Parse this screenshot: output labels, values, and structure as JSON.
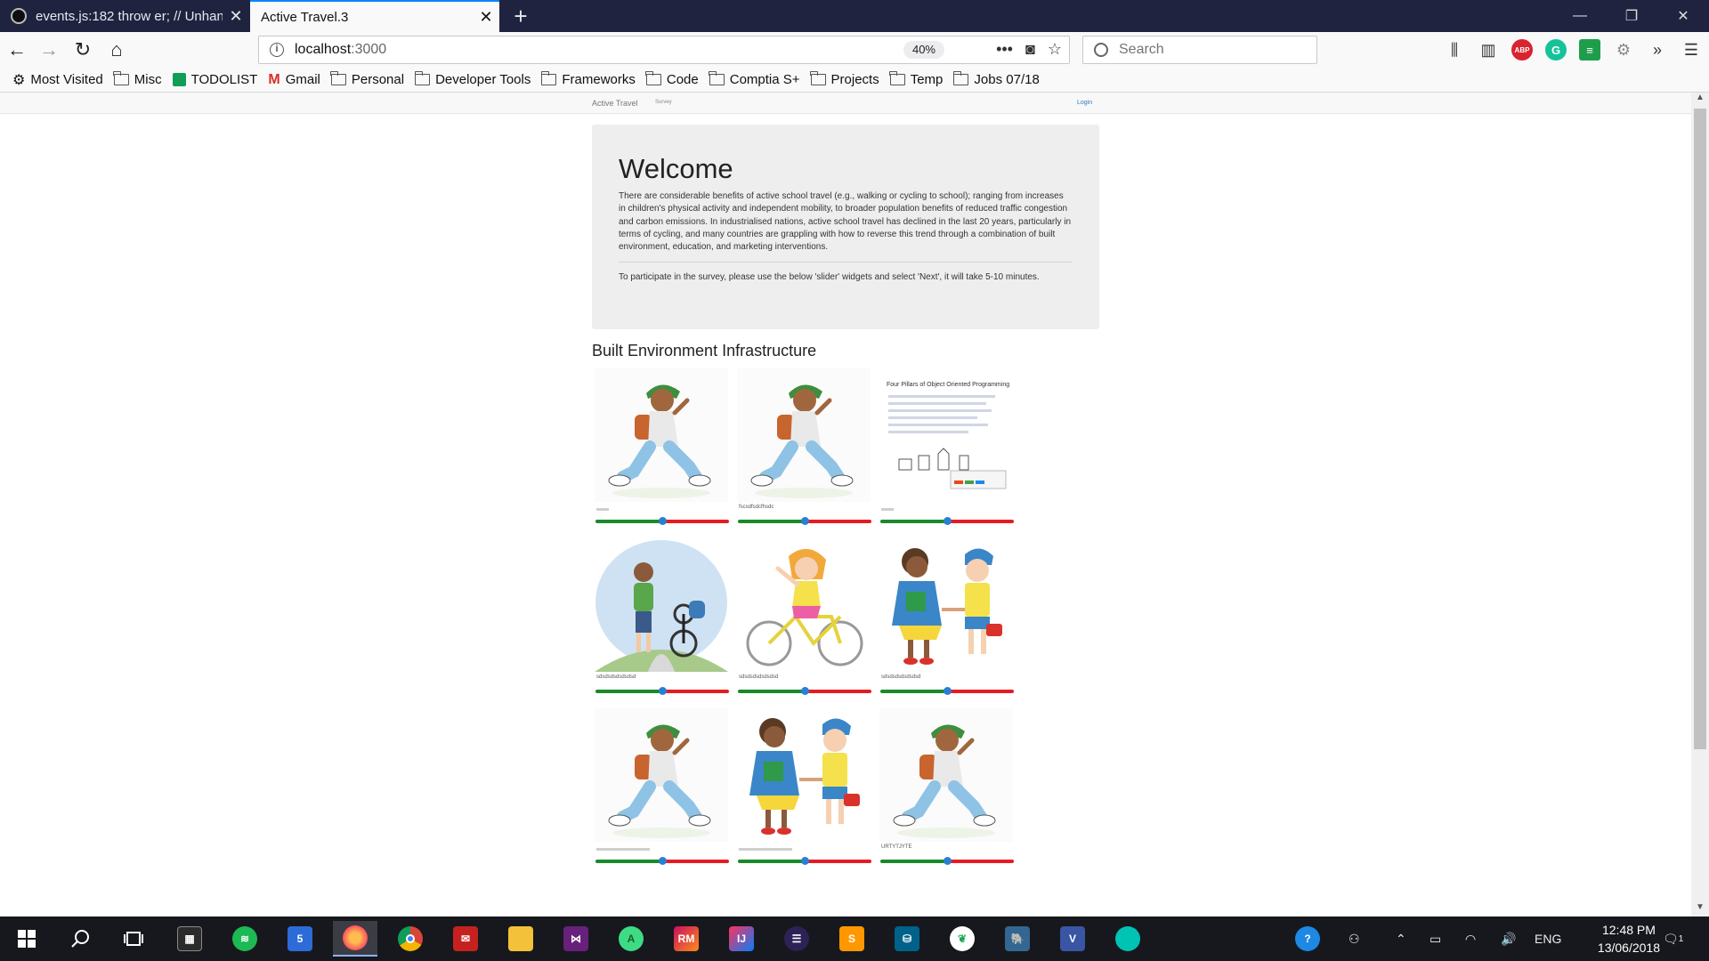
{
  "browser": {
    "tabs": [
      {
        "title": "events.js:182 throw er; // Unhan"
      },
      {
        "title": "Active Travel.3"
      }
    ],
    "new_tab_symbol": "+",
    "url_host": "localhost",
    "url_rest": ":3000",
    "zoom": "40%",
    "search_placeholder": "Search",
    "bookmarks": [
      {
        "label": "Most Visited",
        "icon": "gear-icon"
      },
      {
        "label": "Misc",
        "icon": "folder-icon"
      },
      {
        "label": "TODOLIST",
        "icon": "sheets-icon"
      },
      {
        "label": "Gmail",
        "icon": "gmail-icon"
      },
      {
        "label": "Personal",
        "icon": "folder-icon"
      },
      {
        "label": "Developer Tools",
        "icon": "folder-icon"
      },
      {
        "label": "Frameworks",
        "icon": "folder-icon"
      },
      {
        "label": "Code",
        "icon": "folder-icon"
      },
      {
        "label": "Comptia S+",
        "icon": "folder-icon"
      },
      {
        "label": "Projects",
        "icon": "folder-icon"
      },
      {
        "label": "Temp",
        "icon": "folder-icon"
      },
      {
        "label": "Jobs 07/18",
        "icon": "folder-icon"
      }
    ],
    "toolbar_icons": {
      "abp": "ABP",
      "grammarly": "G"
    }
  },
  "site": {
    "brand": "Active Travel",
    "nav_survey": "Survey",
    "nav_login": "Login",
    "welcome_title": "Welcome",
    "intro": "There are considerable benefits of active school travel (e.g., walking or cycling to school); ranging from increases in children's physical activity and independent mobility, to broader population benefits of reduced traffic congestion and carbon emissions. In industrialised nations, active school travel has declined in the last 20 years, particularly in terms of cycling, and many countries are grappling with how to reverse this trend through a combination of built environment, education, and marketing interventions.",
    "instructions": "To participate in the survey, please use the below 'slider' widgets and select 'Next', it will take 5-10 minutes.",
    "section_title": "Built Environment Infrastructure",
    "cards": [
      {
        "image": "walking-boy",
        "label": "",
        "value": 0.5
      },
      {
        "image": "walking-boy",
        "label": "fscsdfsdcfhsdc",
        "value": 0.5
      },
      {
        "image": "oop-pillars",
        "label": "",
        "value": 0.5
      },
      {
        "image": "boy-with-bike",
        "label": "sdsdsdsdsdsdsd",
        "value": 0.5
      },
      {
        "image": "girl-cycling",
        "label": "sdsdsdsdsdsdsd",
        "value": 0.5
      },
      {
        "image": "kids-holding-hands",
        "label": "sdsdsdsdsdsdsd",
        "value": 0.5
      },
      {
        "image": "walking-boy",
        "label": "",
        "value": 0.5
      },
      {
        "image": "kids-holding-hands",
        "label": "",
        "value": 0.5
      },
      {
        "image": "walking-boy",
        "label": "URTYTJYTE",
        "value": 0.5
      }
    ],
    "oop_image_title": "Four Pillars of Object Oriented Programming"
  },
  "taskbar": {
    "calendar_day": "5",
    "rider_label": "RM",
    "intellij_label": "IJ",
    "vs_label": "V",
    "language": "ENG",
    "time": "12:48 PM",
    "date": "13/06/2018",
    "notification_count": "1"
  },
  "colors": {
    "slider_left": "#1a8a2a",
    "slider_right": "#e51c23",
    "slider_knob": "#2a7fd4",
    "accent": "#0a84ff"
  }
}
